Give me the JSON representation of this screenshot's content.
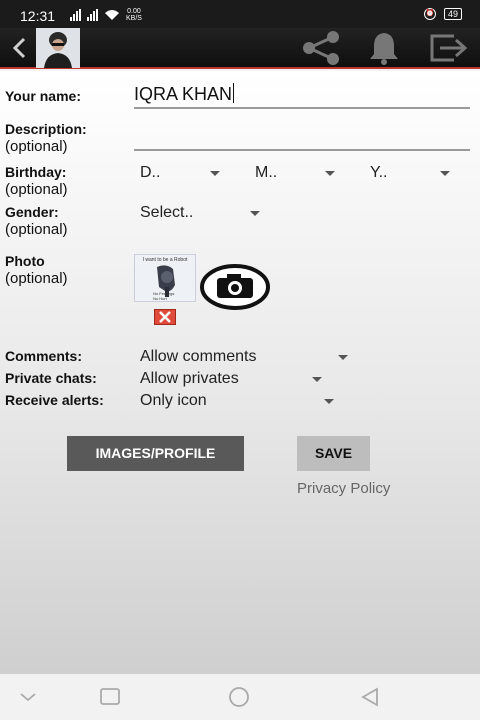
{
  "status": {
    "time": "12:31",
    "speed_value": "0.00",
    "speed_unit": "KB/S",
    "battery": "49"
  },
  "form": {
    "name_label": "Your name:",
    "name_value": "IQRA KHAN",
    "description_label": "Description:",
    "optional": "(optional)",
    "birthday_label": "Birthday:",
    "day_placeholder": "D..",
    "month_placeholder": "M..",
    "year_placeholder": "Y..",
    "gender_label": "Gender:",
    "gender_value": "Select..",
    "photo_label": "Photo",
    "photo_caption": "I want to be a Robot",
    "photo_options": [
      "No Feelings",
      "No Hurt"
    ],
    "comments_label": "Comments:",
    "comments_value": "Allow comments",
    "private_chats_label": "Private chats:",
    "private_chats_value": "Allow privates",
    "alerts_label": "Receive alerts:",
    "alerts_value": "Only icon"
  },
  "actions": {
    "images_profile": "IMAGES/PROFILE",
    "save": "SAVE",
    "privacy_policy": "Privacy Policy"
  },
  "colors": {
    "appbar_accent": "#c0352b",
    "images_button": "#595959",
    "save_button": "#bdbdbd"
  }
}
